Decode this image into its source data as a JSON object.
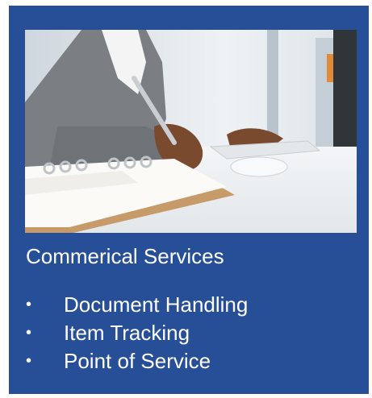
{
  "card": {
    "background_color": "#274f97",
    "text_color": "#ffffff"
  },
  "photo": {
    "icon": "person-writing-in-notebook-image"
  },
  "heading": "Commerical Services",
  "services": [
    {
      "bullet": "•",
      "label": "Document Handling"
    },
    {
      "bullet": "•",
      "label": "Item Tracking"
    },
    {
      "bullet": "•",
      "label": "Point of Service"
    }
  ]
}
